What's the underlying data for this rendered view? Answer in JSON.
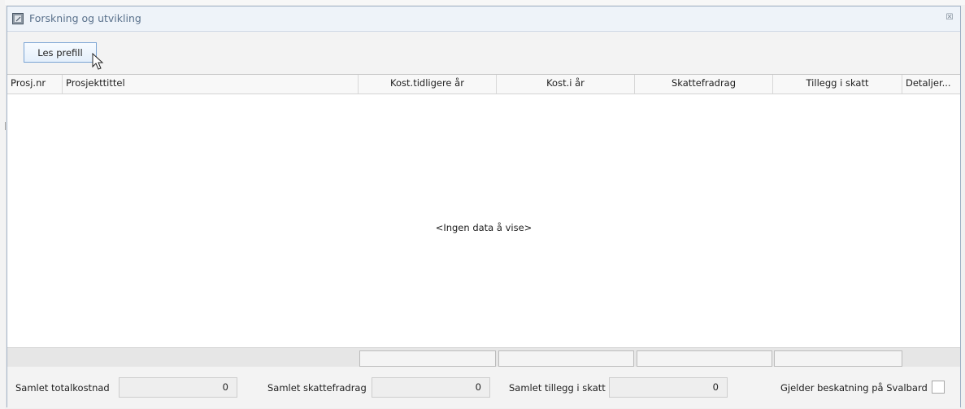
{
  "window": {
    "title": "Forskning og utvikling",
    "close_symbol": "☒"
  },
  "toolbar": {
    "read_prefill_label": "Les prefill"
  },
  "grid": {
    "columns": [
      "Prosj.nr",
      "Prosjekttittel",
      "Kost.tidligere år",
      "Kost.i år",
      "Skattefradrag",
      "Tillegg i skatt",
      "Detaljer..."
    ],
    "empty_message": "<Ingen data å vise>"
  },
  "summary": {
    "total_cost_label": "Samlet totalkostnad",
    "total_cost_value": "0",
    "tax_deduction_label": "Samlet skattefradrag",
    "tax_deduction_value": "0",
    "tax_addition_label": "Samlet tillegg i skatt",
    "tax_addition_value": "0",
    "svalbard_label": "Gjelder beskatning på Svalbard",
    "svalbard_checked": false
  }
}
